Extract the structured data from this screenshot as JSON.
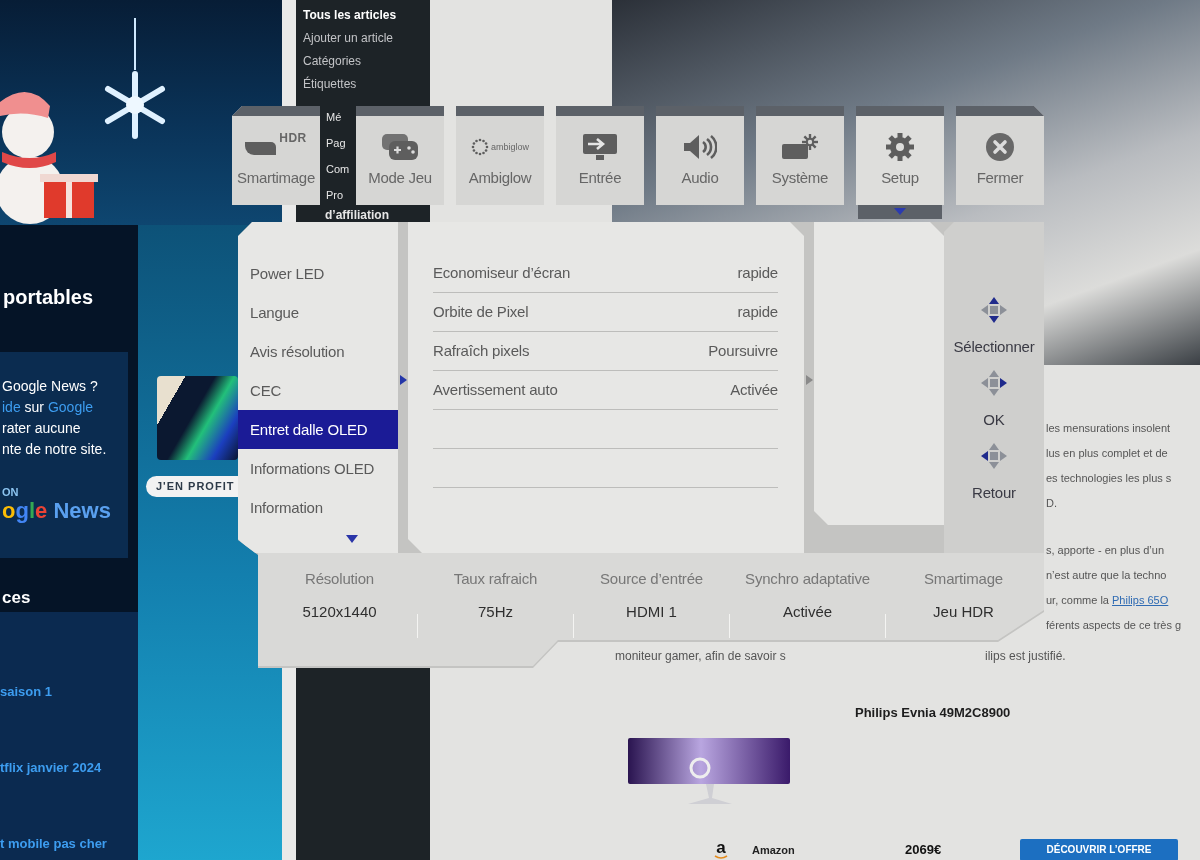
{
  "site_sidebar": {
    "heading": "portables",
    "promo_lines": [
      {
        "segments": [
          {
            "kind": "text",
            "text": "Google News ?"
          }
        ]
      },
      {
        "segments": [
          {
            "kind": "link",
            "text": "ide"
          },
          {
            "kind": "text",
            "text": " sur "
          },
          {
            "kind": "link",
            "text": "Google"
          }
        ]
      },
      {
        "segments": [
          {
            "kind": "text",
            "text": "rater aucune"
          }
        ]
      },
      {
        "segments": [
          {
            "kind": "text",
            "text": "nte de notre site."
          }
        ]
      }
    ],
    "badge": {
      "caption": "ON",
      "wordmark": "ogle News"
    },
    "list_heading": "ces",
    "links": [
      "saison 1",
      "tflix janvier 2024",
      "t mobile pas cher"
    ],
    "ad_button": "J'EN PROFIT"
  },
  "admin_menu": {
    "items": [
      {
        "label": "Tous les articles",
        "selected": true
      },
      {
        "label": "Ajouter un article",
        "selected": false
      },
      {
        "label": "Catégories",
        "selected": false
      },
      {
        "label": "Étiquettes",
        "selected": false
      }
    ],
    "cut_items": [
      "Mé",
      "Pag",
      "Com",
      "Pro",
      "d’affiliation"
    ]
  },
  "article": {
    "paragraphs": [
      [
        {
          "segments": [
            {
              "kind": "text",
              "text": "les mensurations insolent"
            }
          ]
        },
        {
          "segments": [
            {
              "kind": "text",
              "text": "lus en plus complet et de"
            }
          ]
        },
        {
          "segments": [
            {
              "kind": "text",
              "text": "es technologies les plus s"
            }
          ]
        },
        {
          "segments": [
            {
              "kind": "text",
              "text": "D."
            }
          ]
        }
      ],
      [
        {
          "segments": [
            {
              "kind": "text",
              "text": "s, apporte - en plus d’un"
            }
          ]
        },
        {
          "segments": [
            {
              "kind": "text",
              "text": "n’est autre que la techno"
            }
          ]
        },
        {
          "segments": [
            {
              "kind": "text",
              "text": "ur, comme la "
            },
            {
              "kind": "link",
              "text": "Philips 65O"
            }
          ]
        },
        {
          "segments": [
            {
              "kind": "text",
              "text": "férents aspects de ce très g"
            }
          ]
        }
      ]
    ],
    "cut_line": [
      "moniteur gamer, afin de savoir s",
      "ilips est justifié."
    ]
  },
  "product": {
    "title": "Philips Evnia 49M2C8900",
    "store_logo": "a",
    "store": "Amazon",
    "price": "2069€",
    "button": "DÉCOUVRIR L’OFFRE"
  },
  "osd": {
    "tabs": [
      {
        "label": "Smartimage",
        "kind": "hdr",
        "badge": "HDR",
        "selected": false
      },
      {
        "label": "Mode Jeu",
        "kind": "gamepad",
        "selected": false
      },
      {
        "label": "Ambiglow",
        "kind": "ambiglow",
        "badge": "ambiglow",
        "selected": false
      },
      {
        "label": "Entrée",
        "kind": "input",
        "selected": false
      },
      {
        "label": "Audio",
        "kind": "audio",
        "selected": false
      },
      {
        "label": "Système",
        "kind": "system",
        "selected": false
      },
      {
        "label": "Setup",
        "kind": "setup",
        "selected": true
      },
      {
        "label": "Fermer",
        "kind": "close",
        "selected": false
      }
    ],
    "menu": {
      "items": [
        {
          "label": "Power LED",
          "selected": false
        },
        {
          "label": "Langue",
          "selected": false
        },
        {
          "label": "Avis résolution",
          "selected": false
        },
        {
          "label": "CEC",
          "selected": false
        },
        {
          "label": "Entret dalle OLED",
          "selected": true
        },
        {
          "label": "Informations OLED",
          "selected": false
        },
        {
          "label": "Information",
          "selected": false
        }
      ],
      "more_below": true
    },
    "submenu": {
      "rows": [
        {
          "label": "Economiseur d’écran",
          "value": "rapide"
        },
        {
          "label": "Orbite de Pixel",
          "value": "rapide"
        },
        {
          "label": "Rafraîch pixels",
          "value": "Poursuivre"
        },
        {
          "label": "Avertissement auto",
          "value": "Activée"
        }
      ]
    },
    "key_guide": [
      {
        "label": "Sélectionner",
        "kind": "vertical"
      },
      {
        "label": "OK",
        "kind": "right"
      },
      {
        "label": "Retour",
        "kind": "left"
      }
    ],
    "status_bar": [
      {
        "label": "Résolution",
        "value": "5120x1440"
      },
      {
        "label": "Taux rafraich",
        "value": "75Hz"
      },
      {
        "label": "Source d’entrée",
        "value": "HDMI 1"
      },
      {
        "label": "Synchro adaptative",
        "value": "Activée"
      },
      {
        "label": "Smartimage",
        "value": "Jeu HDR"
      }
    ]
  }
}
